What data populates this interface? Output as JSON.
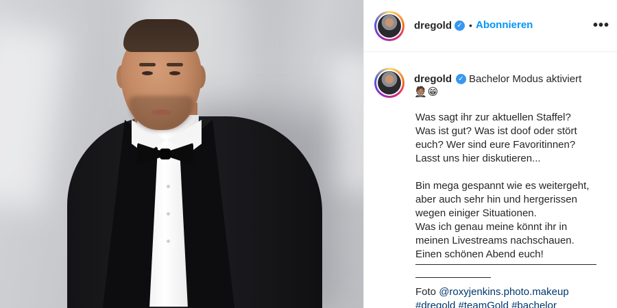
{
  "post": {
    "username": "dregold",
    "follow_label": "Abonnieren",
    "separator": "•",
    "more_label": "•••",
    "verified_glyph": "✓"
  },
  "caption": {
    "first_line": "Bachelor Modus aktiviert",
    "emojis": "🤵🏽😁",
    "paragraph1": "Was sagt ihr zur aktuellen Staffel?\nWas ist gut? Was ist doof oder stört\neuch? Wer sind eure Favoritinnen?\nLasst uns hier diskutieren...",
    "paragraph2": "Bin mega gespannt wie es weitergeht,\naber auch sehr hin und hergerissen\nwegen einiger Situationen.\nWas ich genau meine könnt ihr in\nmeinen Livestreams nachschauen.\nEinen schönen Abend euch!",
    "photo_label": "Foto",
    "photo_credit": "@roxyjenkins.photo.makeup",
    "hashtags": "#dregold #teamGold #bachelor"
  },
  "colors": {
    "accent": "#0095f6",
    "verified": "#3897f0",
    "link": "#00376b"
  }
}
